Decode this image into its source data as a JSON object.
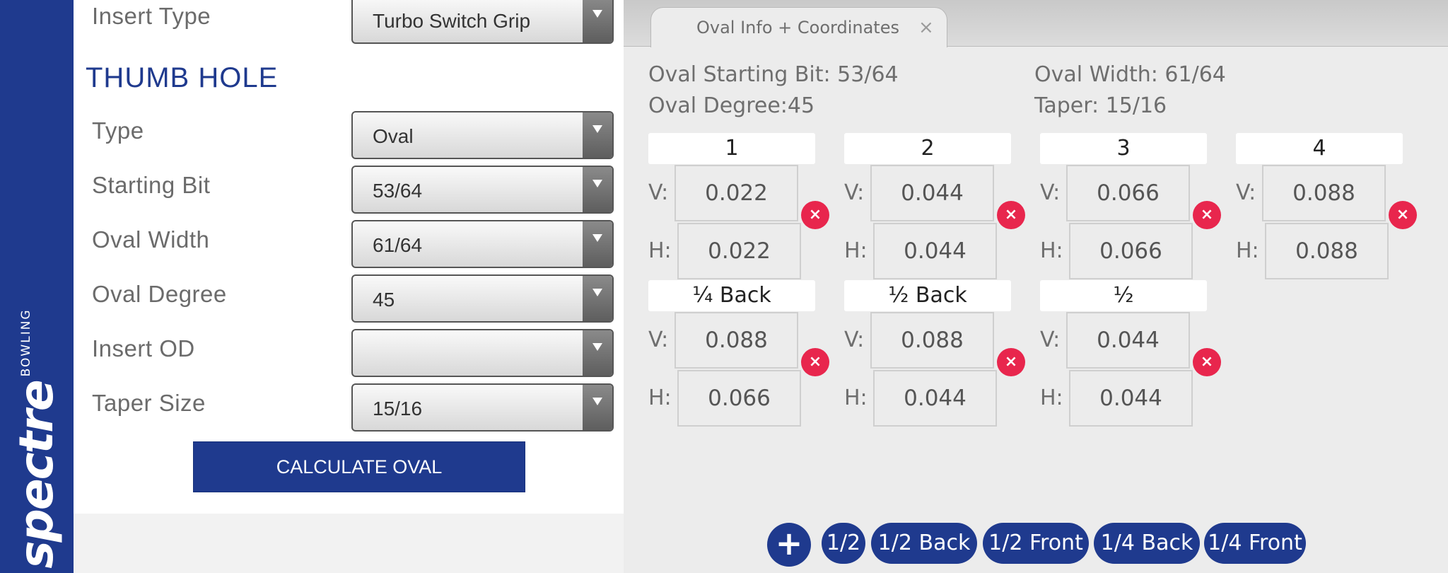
{
  "brand": {
    "word": "spectre",
    "sub": "BOWLING"
  },
  "form": {
    "insert_type": {
      "label": "Insert Type",
      "value": "Turbo Switch Grip"
    },
    "section_title": "THUMB HOLE",
    "type": {
      "label": "Type",
      "value": "Oval"
    },
    "starting_bit": {
      "label": "Starting Bit",
      "value": "53/64"
    },
    "oval_width": {
      "label": "Oval Width",
      "value": "61/64"
    },
    "oval_degree": {
      "label": "Oval Degree",
      "value": "45"
    },
    "insert_od": {
      "label": "Insert OD",
      "value": ""
    },
    "taper_size": {
      "label": "Taper Size",
      "value": "15/16"
    },
    "calculate_label": "CALCULATE OVAL"
  },
  "tab": {
    "label": "Oval Info + Coordinates",
    "close_icon": "×"
  },
  "summary": {
    "starting_bit": "Oval Starting Bit: 53/64",
    "oval_width": "Oval Width: 61/64",
    "oval_degree": "Oval Degree:45",
    "taper": "Taper: 15/16"
  },
  "axis": {
    "v": "V:",
    "h": "H:"
  },
  "remove_icon": "×",
  "coordinates": [
    {
      "title": "1",
      "v": "0.022",
      "h": "0.022"
    },
    {
      "title": "2",
      "v": "0.044",
      "h": "0.044"
    },
    {
      "title": "3",
      "v": "0.066",
      "h": "0.066"
    },
    {
      "title": "4",
      "v": "0.088",
      "h": "0.088"
    },
    {
      "title": "¼ Back",
      "v": "0.088",
      "h": "0.066"
    },
    {
      "title": "½ Back",
      "v": "0.088",
      "h": "0.044"
    },
    {
      "title": "½",
      "v": "0.044",
      "h": "0.044"
    }
  ],
  "bottom": {
    "add": "+",
    "pills": [
      "1/2",
      "1/2 Back",
      "1/2 Front",
      "1/4 Back",
      "1/4 Front"
    ]
  },
  "colors": {
    "brand_blue": "#1f3a8e",
    "remove_red": "#e8264d"
  }
}
